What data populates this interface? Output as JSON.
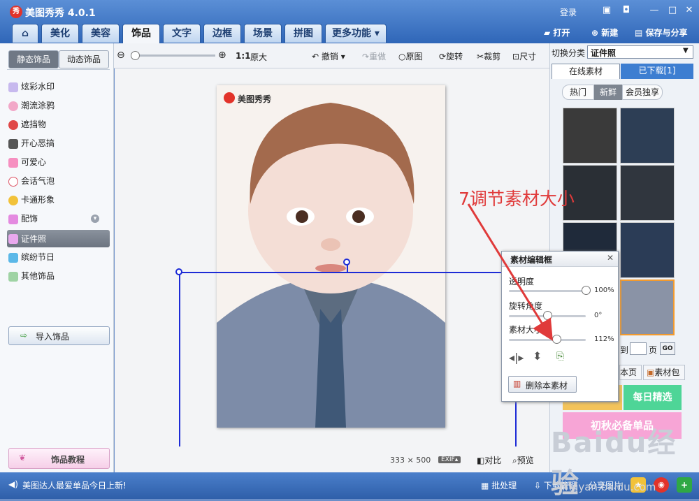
{
  "app": {
    "title": "美图秀秀 4.0.1",
    "logo_char": "秀",
    "login": "登录"
  },
  "tabs": [
    {
      "label": "美化"
    },
    {
      "label": "美容"
    },
    {
      "label": "饰品"
    },
    {
      "label": "文字"
    },
    {
      "label": "边框"
    },
    {
      "label": "场景"
    },
    {
      "label": "拼图"
    },
    {
      "label": "更多功能"
    }
  ],
  "top_actions": {
    "open": "打开",
    "new": "新建",
    "save": "保存与分享"
  },
  "toolbar": {
    "ratio": "1:1",
    "original_size": "原大",
    "undo": "撤销",
    "redo": "重做",
    "original": "原图",
    "rotate": "旋转",
    "crop": "裁剪",
    "size": "尺寸"
  },
  "left": {
    "tab_static": "静态饰品",
    "tab_dynamic": "动态饰品",
    "items": [
      "炫彩水印",
      "潮流涂鸦",
      "遮挡物",
      "开心恶搞",
      "可爱心",
      "会话气泡",
      "卡通形象",
      "配饰",
      "证件照",
      "缤纷节日",
      "其他饰品"
    ],
    "selected": "证件照",
    "import": "导入饰品",
    "tutorial": "饰品教程"
  },
  "canvas": {
    "photo_watermark": "美图秀秀",
    "dims_w": "333",
    "dims_x": "×",
    "dims_h": "500",
    "exif": "EXIF",
    "compare": "对比",
    "preview": "预览"
  },
  "right": {
    "switch_label": "切换分类",
    "category": "证件照",
    "tab_online": "在线素材",
    "tab_downloaded": "已下载[1]",
    "subtabs": [
      "热门",
      "新鲜",
      "会员独享"
    ],
    "page_to": "到",
    "page_unit": "页",
    "go": "GO",
    "this_page": "本页",
    "material_pack": "素材包",
    "ad1": "每日精选",
    "ad2": "初秋必备单品"
  },
  "editor": {
    "title": "素材编辑框",
    "opacity_label": "透明度",
    "opacity_value": "100%",
    "opacity": 1.0,
    "rotation_label": "旋转角度",
    "rotation_value": "0°",
    "rotation": 0.5,
    "size_label": "素材大小",
    "size_value": "112%",
    "size": 0.62,
    "delete": "删除本素材"
  },
  "annotation": "7调节素材大小",
  "status": {
    "news": "美图达人最爱单品今日上新!",
    "batch": "批处理",
    "download": "下载管理",
    "share": "分享图片"
  },
  "watermark": {
    "brand": "Baidu经验",
    "url": "jingyan.baidu.com"
  },
  "colors": {
    "accent": "#2f66b8",
    "annot": "#e03a3a",
    "selection": "#1d2bd6"
  }
}
